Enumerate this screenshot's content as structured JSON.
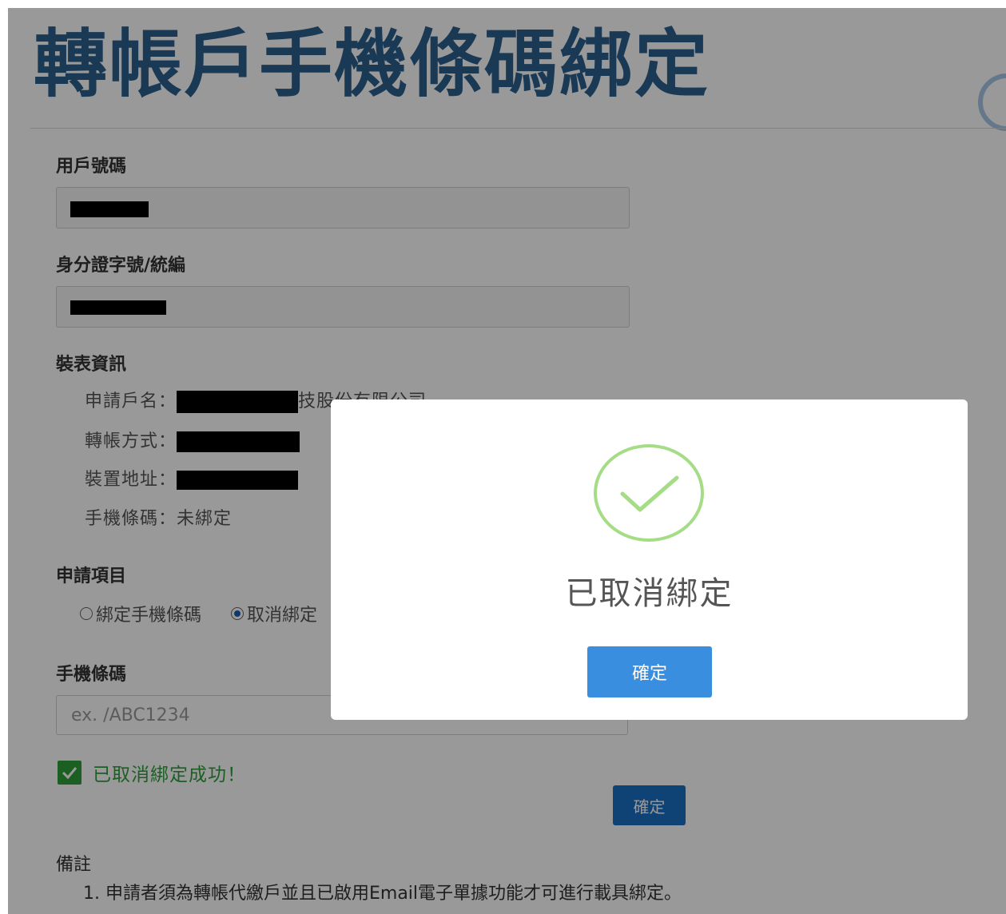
{
  "page": {
    "title": "轉帳戶手機條碼綁定"
  },
  "form": {
    "account_number_label": "用戶號碼",
    "id_number_label": "身分證字號/統編",
    "meter_info_label": "裝表資訊",
    "meter_info": {
      "applicant_name_label": "申請戶名：",
      "applicant_name_visible": "技股份有限公司",
      "transfer_method_label": "轉帳方式：",
      "device_address_label": "裝置地址：",
      "mobile_barcode_label": "手機條碼：",
      "mobile_barcode_value": "未綁定"
    },
    "application_item_label": "申請項目",
    "application_options": [
      {
        "label": "綁定手機條碼",
        "selected": false
      },
      {
        "label": "取消綁定",
        "selected": true
      }
    ],
    "mobile_barcode_label": "手機條碼",
    "mobile_barcode_placeholder": "ex. /ABC1234",
    "success_message": "已取消綁定成功！",
    "confirm_label": "確定"
  },
  "remarks": {
    "label": "備註",
    "items": [
      "1. 申請者須為轉帳代繳戶並且已啟用Email電子單據功能才可進行載具綁定。"
    ]
  },
  "modal": {
    "message": "已取消綁定",
    "confirm_label": "確定",
    "icon": "check-circle-icon"
  },
  "colors": {
    "title": "#2c5f8e",
    "success": "#2e9e3a",
    "primary_button": "#3a8ee0",
    "modal_check": "#a5dc86"
  }
}
